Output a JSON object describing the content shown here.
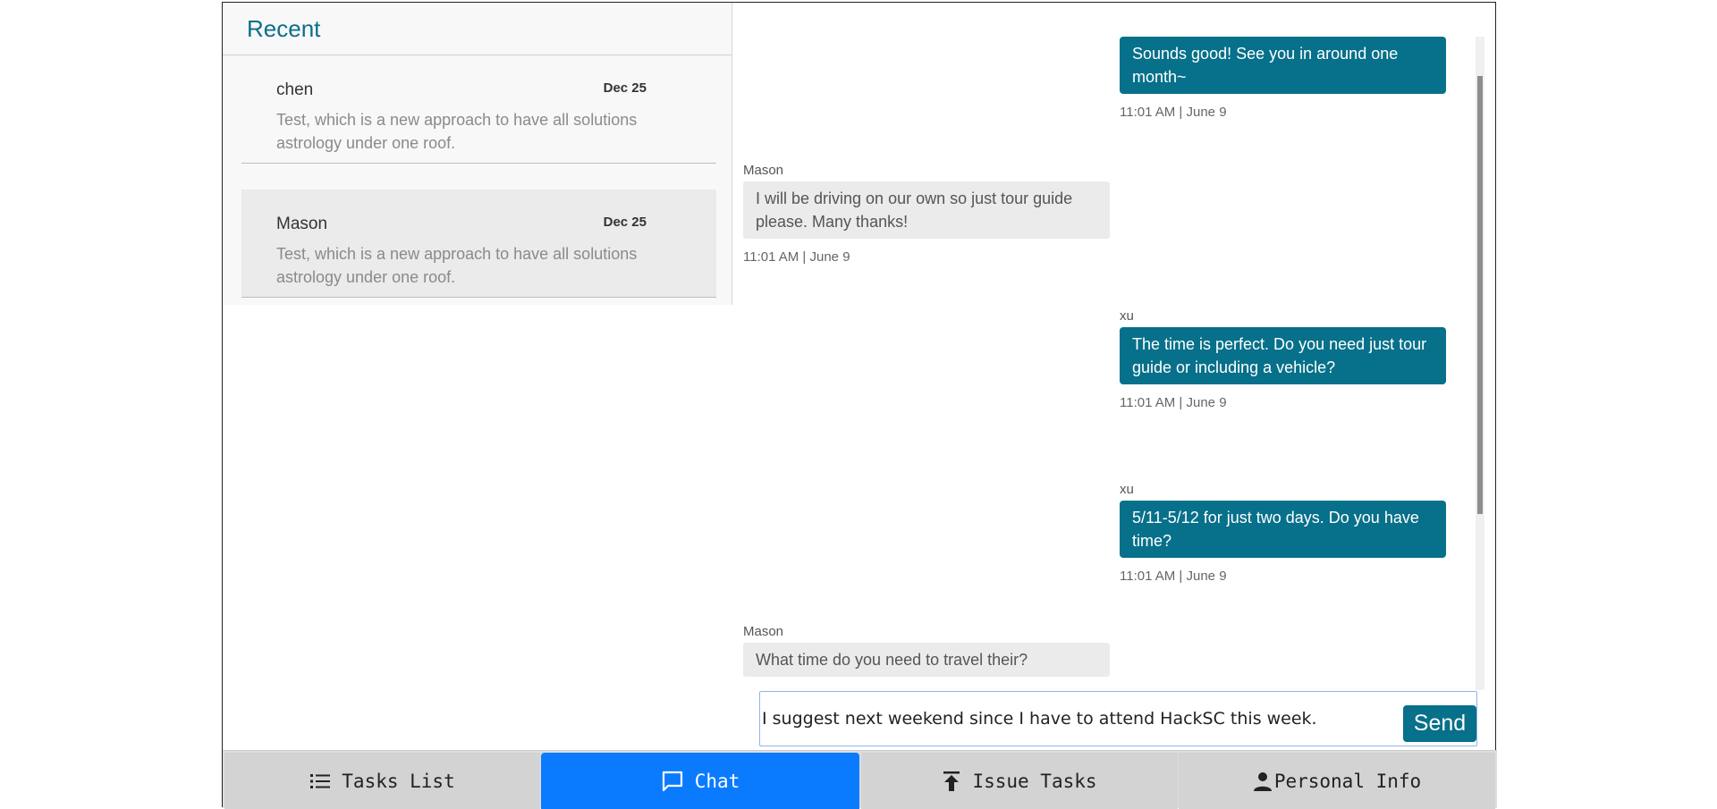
{
  "sidebar": {
    "title": "Recent",
    "conversations": [
      {
        "name": "chen",
        "date": "Dec 25",
        "preview": "Test, which is a new approach to have all solutions astrology under one roof."
      },
      {
        "name": "Mason",
        "date": "Dec 25",
        "preview": "Test, which is a new approach to have all solutions astrology under one roof."
      }
    ]
  },
  "messages": [
    {
      "direction": "out",
      "sender": "",
      "text": "Sounds good! See you in around one month~",
      "time": "11:01 AM | June 9"
    },
    {
      "direction": "in",
      "sender": "Mason",
      "text": "I will be driving on our own so just tour guide please. Many thanks!",
      "time": "11:01 AM | June 9"
    },
    {
      "direction": "out",
      "sender": "xu",
      "text": "The time is perfect. Do you need just tour guide or including a vehicle?",
      "time": "11:01 AM | June 9"
    },
    {
      "direction": "out",
      "sender": "xu",
      "text": "5/11-5/12 for just two days. Do you have time?",
      "time": "11:01 AM | June 9"
    },
    {
      "direction": "in",
      "sender": "Mason",
      "text": "What time do you need to travel their?",
      "time": ""
    }
  ],
  "composer": {
    "value": "I suggest next weekend since I have to attend HackSC this week.",
    "send_label": "Send"
  },
  "tabs": [
    {
      "label": "Tasks List",
      "icon": "list-icon",
      "active": false
    },
    {
      "label": "Chat",
      "icon": "chat-icon",
      "active": true
    },
    {
      "label": "Issue Tasks",
      "icon": "upload-icon",
      "active": false
    },
    {
      "label": "Personal Info",
      "icon": "person-icon",
      "active": false
    }
  ],
  "colors": {
    "accent": "#07708a",
    "active_tab": "#0a7bff"
  }
}
